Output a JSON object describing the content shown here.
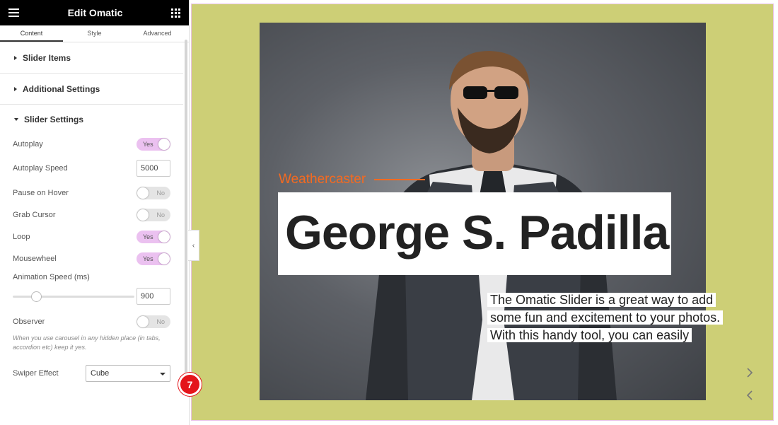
{
  "header": {
    "title": "Edit Omatic"
  },
  "tabs": [
    {
      "label": "Content",
      "active": true
    },
    {
      "label": "Style",
      "active": false
    },
    {
      "label": "Advanced",
      "active": false
    }
  ],
  "sections": {
    "slider_items": "Slider Items",
    "additional_settings": "Additional Settings",
    "slider_settings": "Slider Settings"
  },
  "settings": {
    "autoplay": {
      "label": "Autoplay",
      "value": "Yes",
      "on": true
    },
    "autoplay_speed": {
      "label": "Autoplay Speed",
      "value": "5000"
    },
    "pause_on_hover": {
      "label": "Pause on Hover",
      "value": "No",
      "on": false
    },
    "grab_cursor": {
      "label": "Grab Cursor",
      "value": "No",
      "on": false
    },
    "loop": {
      "label": "Loop",
      "value": "Yes",
      "on": true
    },
    "mousewheel": {
      "label": "Mousewheel",
      "value": "Yes",
      "on": true
    },
    "animation_speed": {
      "label": "Animation Speed (ms)",
      "value": "900",
      "slider_fraction": 0.16
    },
    "observer": {
      "label": "Observer",
      "value": "No",
      "on": false
    },
    "observer_hint": "When you use carousel in any hidden place (in tabs, accordion etc) keep it yes.",
    "swiper_effect": {
      "label": "Swiper Effect",
      "value": "Cube"
    }
  },
  "step_badge": "7",
  "preview": {
    "subtitle": "Weathercaster",
    "name": "George S. Padilla",
    "description": "The Omatic Slider is a great way to add some fun and excitement to your photos. With this handy tool, you can easily"
  },
  "colors": {
    "accent_orange": "#f56a20",
    "stage_bg": "#cdcf76",
    "toggle_on": "#ebc1f0",
    "badge_red": "#e4151b"
  },
  "icons": {
    "menu": "hamburger-icon",
    "apps": "grid-icon",
    "next": "chevron-right-icon",
    "prev": "chevron-left-icon",
    "collapse": "chevron-left-icon"
  }
}
